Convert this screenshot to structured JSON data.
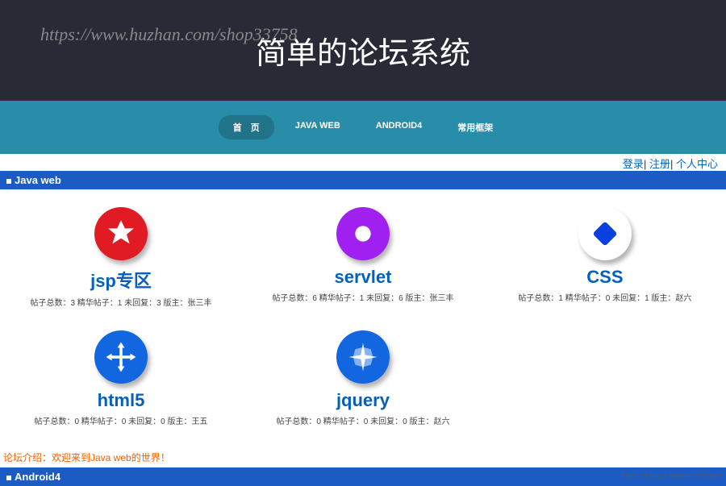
{
  "header": {
    "watermark_url": "https://www.huzhan.com/shop33758",
    "title": "简单的论坛系统"
  },
  "nav": {
    "items": [
      {
        "label": "首　页",
        "active": true
      },
      {
        "label": "JAVA WEB",
        "active": false
      },
      {
        "label": "ANDROID4",
        "active": false
      },
      {
        "label": "常用框架",
        "active": false
      }
    ]
  },
  "auth": {
    "login": "登录",
    "register": "注册",
    "profile": "个人中心",
    "sep": "|"
  },
  "sections": [
    {
      "title": "Java web",
      "intro": "论坛介绍：欢迎来到Java web的世界！",
      "forums": [
        {
          "name": "jsp专区",
          "icon": "star-icon",
          "color": "#e01b24",
          "stats": "帖子总数：3 精华帖子：1 未回复：3 版主：张三丰"
        },
        {
          "name": "servlet",
          "icon": "ring-icon",
          "color": "#a020f0",
          "stats": "帖子总数：6 精华帖子：1 未回复：6 版主：张三丰"
        },
        {
          "name": "CSS",
          "icon": "diamond-icon",
          "color": "#0a3fe0",
          "stats": "帖子总数：1 精华帖子：0 未回复：1 版主：赵六"
        },
        {
          "name": "html5",
          "icon": "arrows-icon",
          "color": "#1266e0",
          "stats": "帖子总数：0 精华帖子：0 未回复：0 版主：王五"
        },
        {
          "name": "jquery",
          "icon": "sparkle-icon",
          "color": "#1266e0",
          "stats": "帖子总数：0 精华帖子：0 未回复：0 版主：赵六"
        }
      ]
    },
    {
      "title": "Android4",
      "intro": "",
      "forums": []
    }
  ],
  "footer": {
    "blog_url": "http://blog.csdn.net/llqqxf"
  }
}
